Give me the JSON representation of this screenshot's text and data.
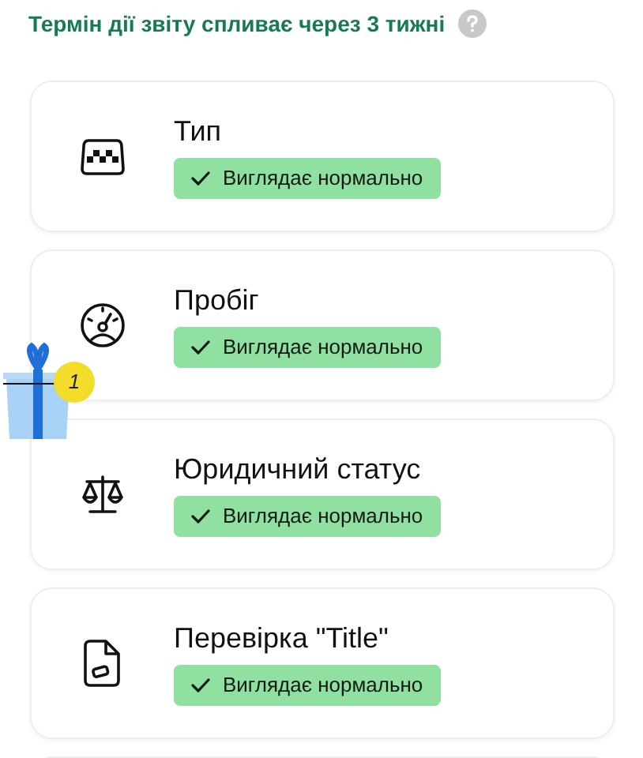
{
  "report_notice": {
    "text": "Термін дії звіту спливає через 3 тижні"
  },
  "checks": [
    {
      "kind": "taxi",
      "title": "Тип",
      "status": {
        "kind": "ok",
        "text": "Виглядає нормально"
      }
    },
    {
      "kind": "gauge",
      "title": "Пробіг",
      "status": {
        "kind": "ok",
        "text": "Виглядає нормально"
      }
    },
    {
      "kind": "scales",
      "title": "Юридичний статус",
      "status": {
        "kind": "ok",
        "text": "Виглядає нормально"
      }
    },
    {
      "kind": "document",
      "title": "Перевірка \"Title\"",
      "status": {
        "kind": "ok",
        "text": "Виглядає нормально"
      }
    }
  ],
  "gift_widget": {
    "count": "1"
  }
}
